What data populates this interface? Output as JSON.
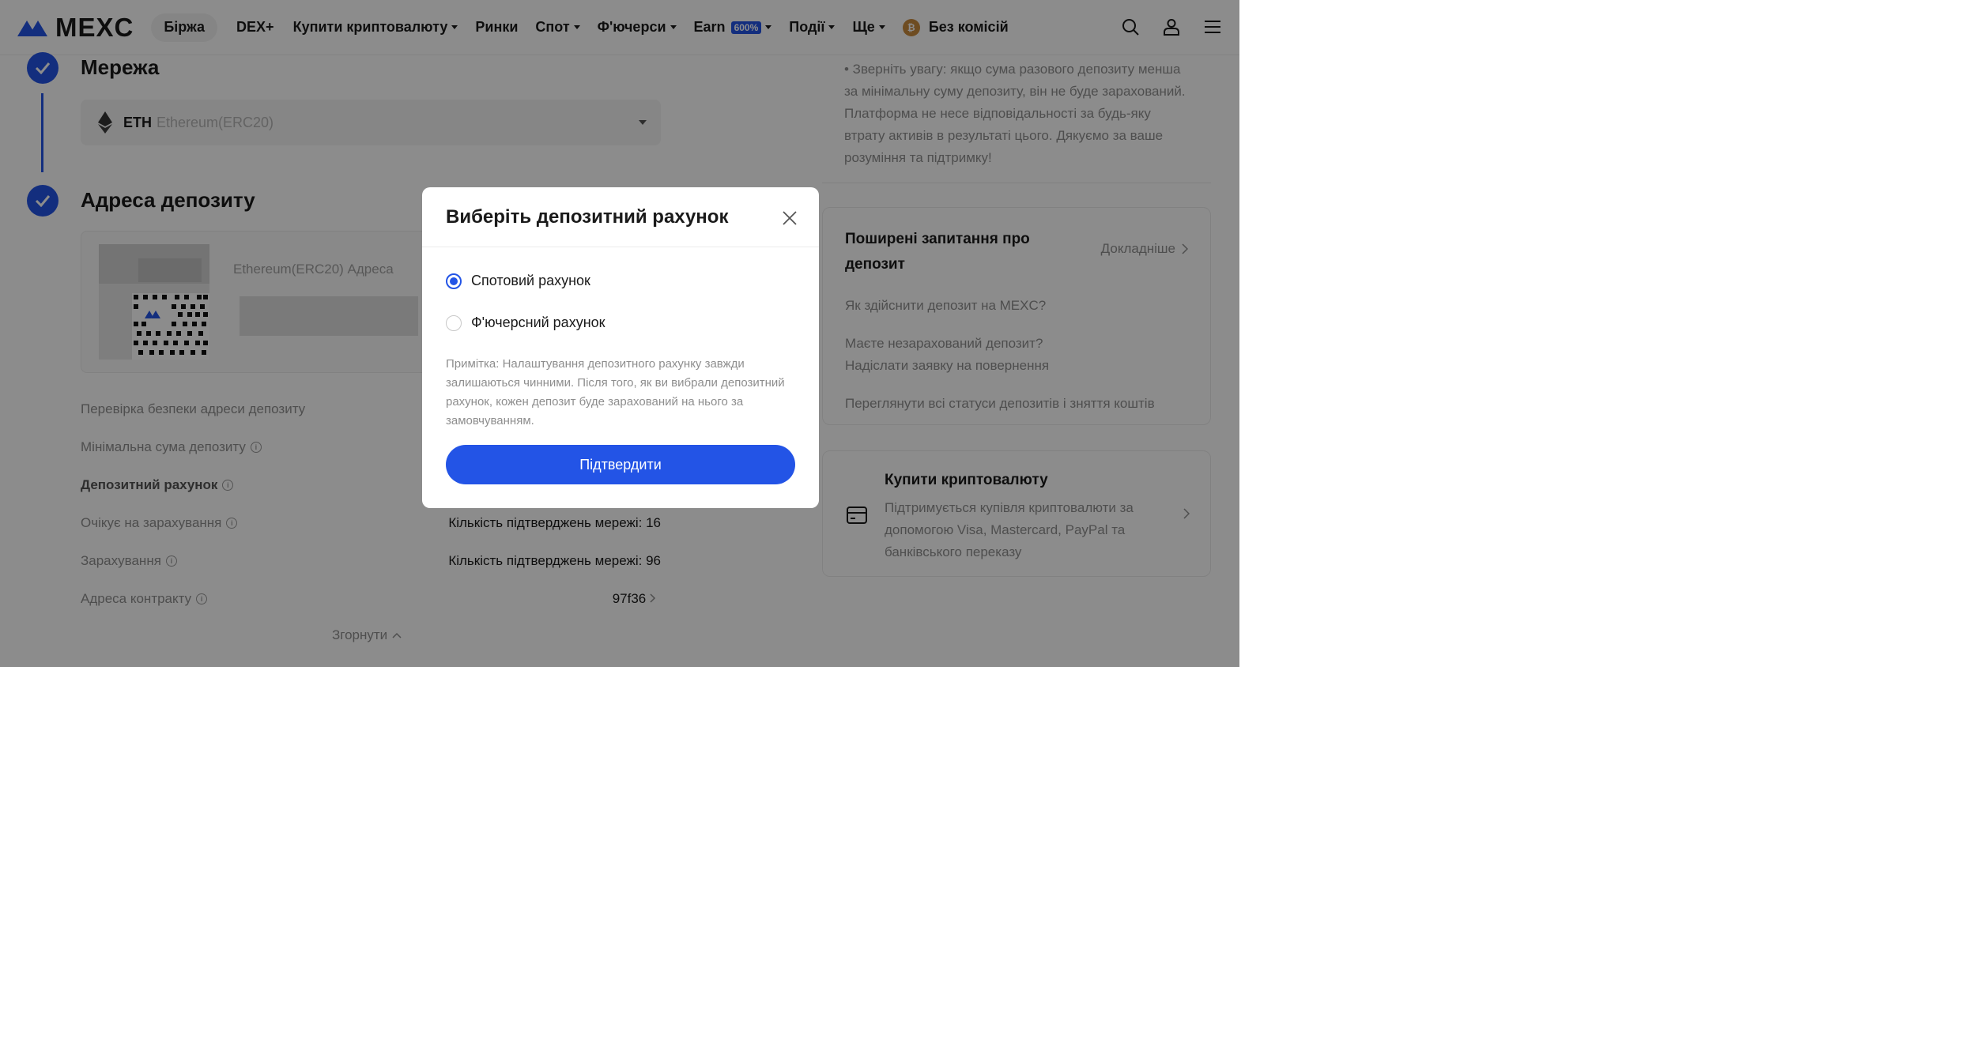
{
  "header": {
    "logo_text": "MEXC",
    "nav": {
      "exchange": "Біржа",
      "dex": "DEX+",
      "buy_crypto": "Купити криптовалюту",
      "markets": "Ринки",
      "spot": "Спот",
      "futures": "Ф'ючерси",
      "earn": "Earn",
      "earn_badge": "600%",
      "events": "Події",
      "more": "Ще",
      "zero_fee": "Без комісій"
    },
    "icons": [
      "search-icon",
      "user-icon",
      "menu-icon"
    ]
  },
  "steps": {
    "network_title": "Мережа",
    "network": {
      "code": "ETH",
      "name": "Ethereum(ERC20)"
    },
    "address_title": "Адреса депозиту",
    "address_label": "Ethereum(ERC20) Адреса"
  },
  "details": {
    "security_check": "Перевірка безпеки адреси депозиту",
    "min_deposit": "Мінімальна сума депозиту",
    "deposit_account": "Депозитний рахунок",
    "pending": "Очікує на зарахування",
    "pending_value": "Кількість підтверджень мережі: 16",
    "credited": "Зарахування",
    "credited_value": "Кількість підтверджень мережі: 96",
    "contract": "Адреса контракту",
    "contract_value": "97f36",
    "collapse": "Згорнути"
  },
  "sidebar": {
    "notice": "• Зверніть увагу: якщо сума разового депозиту менша за мінімальну суму депозиту, він не буде зарахований. Платформа не несе відповідальності за будь-яку втрату активів в результаті цього. Дякуємо за ваше розуміння та підтримку!",
    "faq_title": "Поширені запитання про депозит",
    "faq_more": "Докладніше",
    "faq_links": {
      "how_to": "Як здійснити депозит на MEXC?",
      "uncredited": "Маєте незарахований депозит?",
      "refund": "Надіслати заявку на повернення",
      "statuses": "Переглянути всі статуси депозитів і зняття коштів"
    },
    "buy_title": "Купити криптовалюту",
    "buy_desc": "Підтримується купівля криптовалюти за допомогою Visa, Mastercard, PayPal та банківського переказу"
  },
  "modal": {
    "title": "Виберіть депозитний рахунок",
    "options": {
      "spot": {
        "label": "Спотовий рахунок",
        "selected": true
      },
      "futures": {
        "label": "Ф'ючерсний рахунок",
        "selected": false
      }
    },
    "note": "Примітка: Налаштування депозитного рахунку завжди залишаються чинними. Після того, як ви вибрали депозитний рахунок, кожен депозит буде зарахований на нього за замовчуванням.",
    "confirm": "Підтвердити"
  },
  "colors": {
    "accent": "#2354e6",
    "text": "#1a1a1a",
    "muted": "#8e8e8e"
  }
}
